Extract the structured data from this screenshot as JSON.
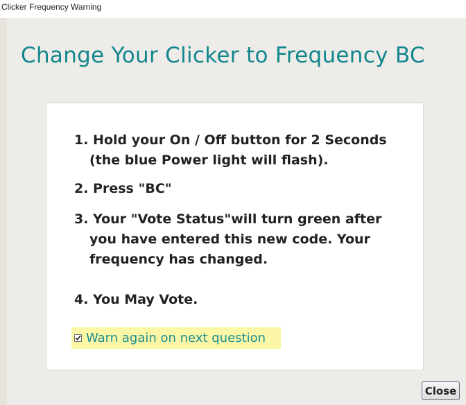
{
  "window": {
    "title": "Clicker Frequency Warning"
  },
  "dialog": {
    "heading": "Change Your Clicker to Frequency BC",
    "steps": [
      {
        "lines": [
          "1. Hold your On / Off button for 2 Seconds",
          "(the blue Power light will flash)."
        ]
      },
      {
        "lines": [
          "2. Press \"BC\""
        ]
      },
      {
        "lines": [
          "3. Your \"Vote Status\"will turn green after",
          "you have entered this new code. Your",
          "frequency has changed."
        ]
      },
      {
        "lines": [
          "4. You May Vote."
        ]
      }
    ],
    "warn_again": {
      "label": "Warn again on next question",
      "checked": true
    },
    "close_label": "Close"
  },
  "colors": {
    "heading": "#12868c",
    "checkbox_label": "#1c8e8e",
    "highlight": "#fbf7a6",
    "frame": "#eeece9",
    "panel": "#ffffff"
  }
}
